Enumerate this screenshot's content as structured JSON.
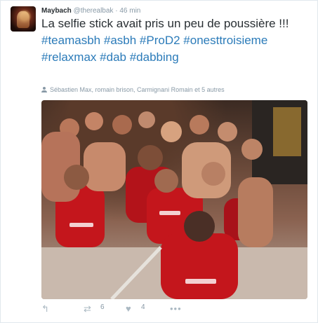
{
  "tweet": {
    "author_name": "Maybach",
    "author_handle": "@therealbak",
    "separator": "·",
    "time": "46 min",
    "text_plain": "La selfie stick avait pris un peu de poussière !!! ",
    "hashtags": [
      "#teamasbh",
      "#asbh",
      "#ProD2",
      "#onesttroisieme",
      "#relaxmax",
      "#dab",
      "#dabbing"
    ],
    "tagged_users": "Sébastien Max, romain brison, Carmignani Romain et 5 autres",
    "retweet_count": "6",
    "like_count": "4"
  },
  "icons": {
    "avatar": "profile-photo",
    "tagged": "user-icon",
    "reply": "reply-icon",
    "retweet": "retweet-icon",
    "like": "heart-icon",
    "more": "more-icon"
  },
  "colors": {
    "link": "#2b7bb9",
    "muted": "#8899a6",
    "text": "#292f33",
    "jersey_red": "#c4161c"
  }
}
